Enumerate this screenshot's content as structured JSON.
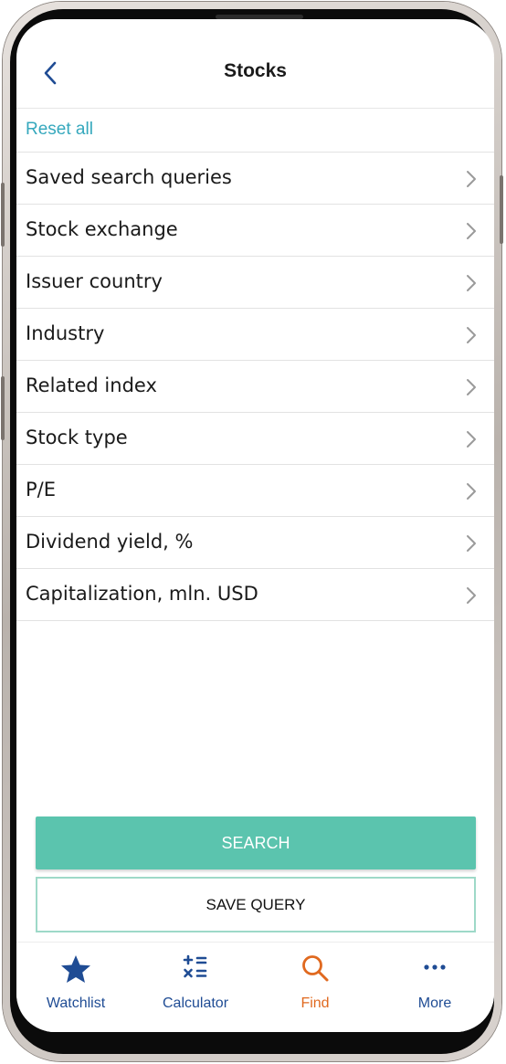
{
  "header": {
    "title": "Stocks",
    "back_icon": "chevron-left-icon"
  },
  "reset_label": "Reset all",
  "filters": [
    {
      "label": "Saved search queries"
    },
    {
      "label": "Stock exchange"
    },
    {
      "label": "Issuer country"
    },
    {
      "label": "Industry"
    },
    {
      "label": "Related index"
    },
    {
      "label": "Stock type"
    },
    {
      "label": "P/E"
    },
    {
      "label": "Dividend yield, %"
    },
    {
      "label": "Capitalization, mln. USD"
    }
  ],
  "actions": {
    "search_label": "SEARCH",
    "save_label": "SAVE QUERY"
  },
  "tabs": [
    {
      "label": "Watchlist",
      "icon": "star-icon"
    },
    {
      "label": "Calculator",
      "icon": "calculator-icon"
    },
    {
      "label": "Find",
      "icon": "search-icon",
      "active": true
    },
    {
      "label": "More",
      "icon": "more-icon"
    }
  ],
  "colors": {
    "accent_teal": "#5bc4ae",
    "link": "#35a8bd",
    "tab_blue": "#1f4c94",
    "tab_active": "#e0691f"
  }
}
